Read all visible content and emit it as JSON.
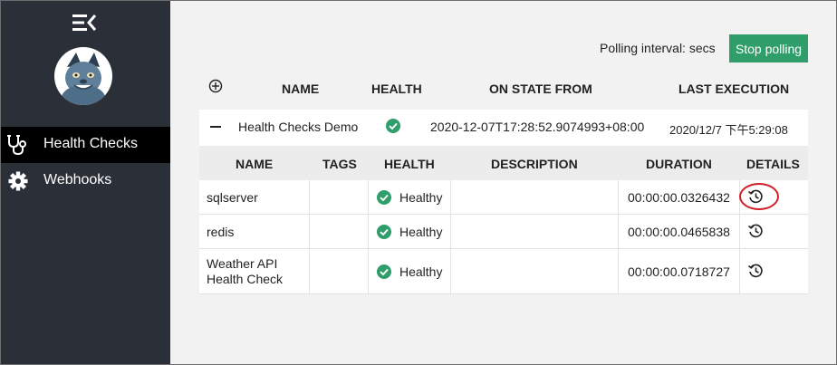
{
  "sidebar": {
    "menu_icon": "menu-collapse-icon",
    "avatar_icon": "mascot-avatar",
    "items": [
      {
        "label": "Health Checks",
        "icon": "stethoscope-icon",
        "active": true
      },
      {
        "label": "Webhooks",
        "icon": "gear-icon",
        "active": false
      }
    ]
  },
  "toolbar": {
    "polling_label": "Polling interval: secs",
    "stop_button_label": "Stop polling",
    "stop_button_color": "#2f9e6a"
  },
  "outer_table": {
    "headers": {
      "name": "NAME",
      "health": "HEALTH",
      "on_state_from": "ON STATE FROM",
      "last_execution": "LAST EXECUTION"
    },
    "group": {
      "name": "Health Checks Demo",
      "health": "healthy",
      "on_state_from": "2020-12-07T17:28:52.9074993+08:00",
      "last_execution": "2020/12/7 下午5:29:08"
    }
  },
  "inner_table": {
    "headers": {
      "name": "NAME",
      "tags": "TAGS",
      "health": "HEALTH",
      "description": "DESCRIPTION",
      "duration": "DURATION",
      "details": "DETAILS"
    },
    "rows": [
      {
        "name": "sqlserver",
        "tags": "",
        "health": "Healthy",
        "description": "",
        "duration": "00:00:00.0326432"
      },
      {
        "name": "redis",
        "tags": "",
        "health": "Healthy",
        "description": "",
        "duration": "00:00:00.0465838"
      },
      {
        "name": "Weather API Health Check",
        "name_line1": "Weather API",
        "name_line2": "Health Check",
        "tags": "",
        "health": "Healthy",
        "description": "",
        "duration": "00:00:00.0718727"
      }
    ]
  },
  "colors": {
    "sidebar_bg": "#2b2f38",
    "healthy_green": "#2f9e6a",
    "highlight_red": "#d21f27"
  }
}
